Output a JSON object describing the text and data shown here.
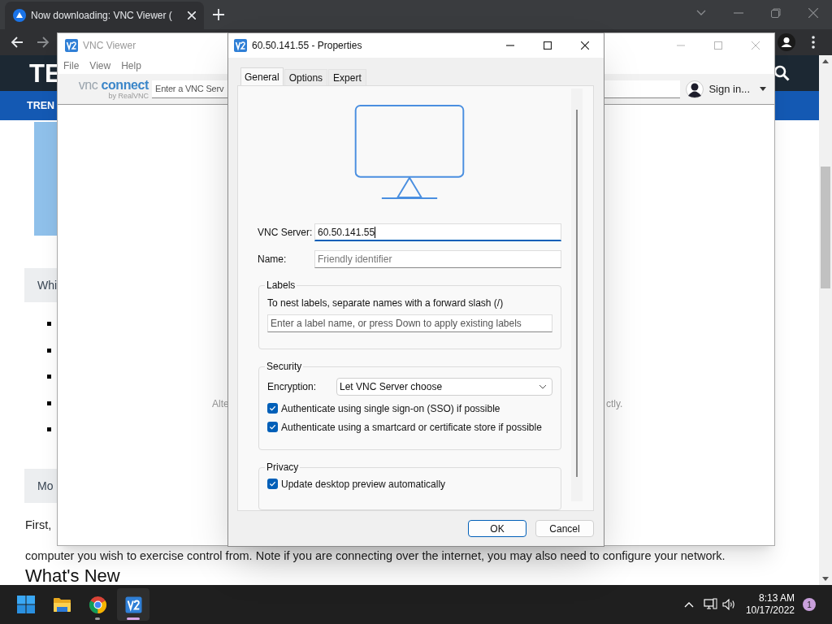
{
  "browser": {
    "tab": {
      "title": "Now downloading: VNC Viewer (",
      "selected": true
    },
    "page": {
      "logo": "TE",
      "nav_item": "TREN",
      "box_1": "Whi",
      "box_2": "Mo",
      "paragraph_line_1": "First,",
      "paragraph_line_2": "computer you wish to exercise control from. Note if you are connecting over the internet, you may also need to configure your network.",
      "heading": "What's New"
    }
  },
  "vnc_viewer": {
    "window_title": "VNC Viewer",
    "menu": [
      "File",
      "View",
      "Help"
    ],
    "logo": {
      "words": [
        "vnc",
        "connect"
      ],
      "byline": "by RealVNC"
    },
    "search": {
      "placeholder": "Enter a VNC Serv"
    },
    "sign_in": "Sign in...",
    "background_text": [
      "Alte",
      "ctly."
    ]
  },
  "dialog": {
    "title": "60.50.141.55 - Properties",
    "tabs": [
      {
        "label": "General",
        "selected": true
      },
      {
        "label": "Options",
        "selected": false
      },
      {
        "label": "Expert",
        "selected": false
      }
    ],
    "vnc_server": {
      "label": "VNC Server:",
      "value": "60.50.141.55",
      "focused": true
    },
    "name": {
      "label": "Name:",
      "placeholder": "Friendly identifier"
    },
    "labels_group": {
      "title": "Labels",
      "hint": "To nest labels, separate names with a forward slash (/)",
      "field": {
        "placeholder": "Enter a label name, or press Down to apply existing labels"
      }
    },
    "security_group": {
      "title": "Security",
      "encryption": {
        "label": "Encryption:",
        "value": "Let VNC Server choose"
      },
      "options": [
        {
          "label": "Authenticate using single sign-on (SSO) if possible",
          "checked": true
        },
        {
          "label": "Authenticate using a smartcard or certificate store if possible",
          "checked": true
        }
      ]
    },
    "privacy_group": {
      "title": "Privacy",
      "options": [
        {
          "label": "Update desktop preview automatically",
          "checked": true
        }
      ]
    },
    "buttons": [
      {
        "label": "OK",
        "default": true
      },
      {
        "label": "Cancel",
        "default": false
      }
    ]
  },
  "taskbar": {
    "apps": [
      {
        "kind": "folder",
        "running": false,
        "selected": false
      },
      {
        "kind": "browser",
        "running": true,
        "selected": false
      },
      {
        "kind": "vnc",
        "running": true,
        "selected": true
      }
    ],
    "clock": {
      "time": "8:13 AM",
      "date": "10/17/2022"
    },
    "notifications": "1"
  }
}
